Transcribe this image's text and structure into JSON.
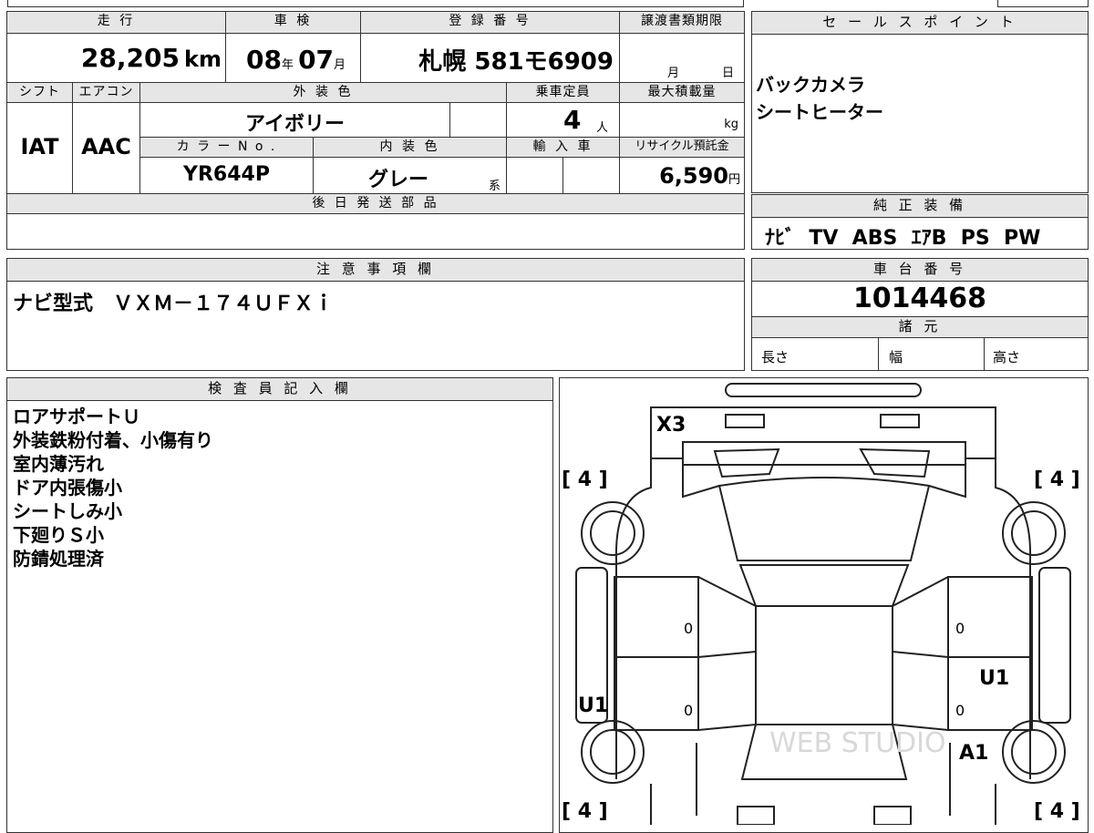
{
  "spec": {
    "labels": {
      "mileage": "走 行",
      "inspection": "車 検",
      "registration": "登 録 番 号",
      "transfer_deadline": "譲渡書類期限",
      "shift": "シフト",
      "aircon": "エアコン",
      "exterior_color": "外 装 色",
      "capacity": "乗車定員",
      "max_load": "最大積載量",
      "color_no": "カ ラ ー N o .",
      "interior_color": "内 装 色",
      "import": "輸 入 車",
      "recycle_fee": "リサイクル預託金",
      "later_parts": "後 日 発 送 部 品"
    },
    "mileage": "28,205",
    "mileage_unit": "km",
    "inspection_year": "08",
    "inspection_year_unit": "年",
    "inspection_month": "07",
    "inspection_month_unit": "月",
    "registration": "札幌 581モ6909",
    "deadline_month_unit": "月",
    "deadline_day_unit": "日",
    "shift": "IAT",
    "aircon": "AAC",
    "exterior_color": "アイボリー",
    "capacity": "4",
    "capacity_unit": "人",
    "max_load_unit": "kg",
    "color_no": "YR644P",
    "interior_color": "グレー",
    "interior_suffix": "系",
    "recycle_fee": "6,590",
    "recycle_unit": "円"
  },
  "sales_points": {
    "title": "セ ー ル ス ポ イ ン ト",
    "items": [
      "バックカメラ",
      "シートヒーター"
    ]
  },
  "equipment": {
    "title": "純 正 装 備",
    "items": "ﾅﾋﾞ  TV  ABS  ｴｱB  PS  PW"
  },
  "notes": {
    "title": "注 意 事 項 欄",
    "text": "ナビ型式　ＶＸＭ－１７４ＵＦＸｉ"
  },
  "chassis": {
    "title": "車 台 番 号",
    "number": "1014468",
    "specs_title": "諸 元",
    "length": "長さ",
    "width": "幅",
    "height": "高さ"
  },
  "inspector": {
    "title": "検 査 員 記 入 欄",
    "lines": [
      "ロアサポートＵ",
      "外装鉄粉付着、小傷有り",
      "室内薄汚れ",
      "ドア内張傷小",
      "シートしみ小",
      "下廻りＳ小",
      "防錆処理済"
    ]
  },
  "diagram": {
    "marks": {
      "front": "X3",
      "left_door": "U1",
      "right_door": "U1",
      "right_rear": "A1",
      "tire_fl": "[ 4 ]",
      "tire_fr": "[ 4 ]",
      "tire_rl": "[ 4 ]",
      "tire_rr": "[ 4 ]",
      "zero1": "0",
      "zero2": "0",
      "zero3": "0",
      "zero4": "0"
    },
    "watermark": "WEB STUDIO"
  }
}
